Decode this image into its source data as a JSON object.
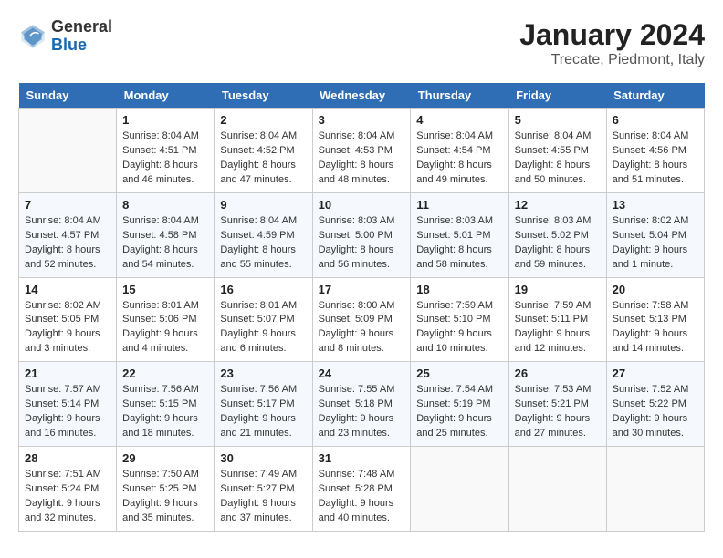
{
  "header": {
    "logo_general": "General",
    "logo_blue": "Blue",
    "title": "January 2024",
    "subtitle": "Trecate, Piedmont, Italy"
  },
  "days_of_week": [
    "Sunday",
    "Monday",
    "Tuesday",
    "Wednesday",
    "Thursday",
    "Friday",
    "Saturday"
  ],
  "weeks": [
    [
      {
        "day": "",
        "info": ""
      },
      {
        "day": "1",
        "info": "Sunrise: 8:04 AM\nSunset: 4:51 PM\nDaylight: 8 hours\nand 46 minutes."
      },
      {
        "day": "2",
        "info": "Sunrise: 8:04 AM\nSunset: 4:52 PM\nDaylight: 8 hours\nand 47 minutes."
      },
      {
        "day": "3",
        "info": "Sunrise: 8:04 AM\nSunset: 4:53 PM\nDaylight: 8 hours\nand 48 minutes."
      },
      {
        "day": "4",
        "info": "Sunrise: 8:04 AM\nSunset: 4:54 PM\nDaylight: 8 hours\nand 49 minutes."
      },
      {
        "day": "5",
        "info": "Sunrise: 8:04 AM\nSunset: 4:55 PM\nDaylight: 8 hours\nand 50 minutes."
      },
      {
        "day": "6",
        "info": "Sunrise: 8:04 AM\nSunset: 4:56 PM\nDaylight: 8 hours\nand 51 minutes."
      }
    ],
    [
      {
        "day": "7",
        "info": "Sunrise: 8:04 AM\nSunset: 4:57 PM\nDaylight: 8 hours\nand 52 minutes."
      },
      {
        "day": "8",
        "info": "Sunrise: 8:04 AM\nSunset: 4:58 PM\nDaylight: 8 hours\nand 54 minutes."
      },
      {
        "day": "9",
        "info": "Sunrise: 8:04 AM\nSunset: 4:59 PM\nDaylight: 8 hours\nand 55 minutes."
      },
      {
        "day": "10",
        "info": "Sunrise: 8:03 AM\nSunset: 5:00 PM\nDaylight: 8 hours\nand 56 minutes."
      },
      {
        "day": "11",
        "info": "Sunrise: 8:03 AM\nSunset: 5:01 PM\nDaylight: 8 hours\nand 58 minutes."
      },
      {
        "day": "12",
        "info": "Sunrise: 8:03 AM\nSunset: 5:02 PM\nDaylight: 8 hours\nand 59 minutes."
      },
      {
        "day": "13",
        "info": "Sunrise: 8:02 AM\nSunset: 5:04 PM\nDaylight: 9 hours\nand 1 minute."
      }
    ],
    [
      {
        "day": "14",
        "info": "Sunrise: 8:02 AM\nSunset: 5:05 PM\nDaylight: 9 hours\nand 3 minutes."
      },
      {
        "day": "15",
        "info": "Sunrise: 8:01 AM\nSunset: 5:06 PM\nDaylight: 9 hours\nand 4 minutes."
      },
      {
        "day": "16",
        "info": "Sunrise: 8:01 AM\nSunset: 5:07 PM\nDaylight: 9 hours\nand 6 minutes."
      },
      {
        "day": "17",
        "info": "Sunrise: 8:00 AM\nSunset: 5:09 PM\nDaylight: 9 hours\nand 8 minutes."
      },
      {
        "day": "18",
        "info": "Sunrise: 7:59 AM\nSunset: 5:10 PM\nDaylight: 9 hours\nand 10 minutes."
      },
      {
        "day": "19",
        "info": "Sunrise: 7:59 AM\nSunset: 5:11 PM\nDaylight: 9 hours\nand 12 minutes."
      },
      {
        "day": "20",
        "info": "Sunrise: 7:58 AM\nSunset: 5:13 PM\nDaylight: 9 hours\nand 14 minutes."
      }
    ],
    [
      {
        "day": "21",
        "info": "Sunrise: 7:57 AM\nSunset: 5:14 PM\nDaylight: 9 hours\nand 16 minutes."
      },
      {
        "day": "22",
        "info": "Sunrise: 7:56 AM\nSunset: 5:15 PM\nDaylight: 9 hours\nand 18 minutes."
      },
      {
        "day": "23",
        "info": "Sunrise: 7:56 AM\nSunset: 5:17 PM\nDaylight: 9 hours\nand 21 minutes."
      },
      {
        "day": "24",
        "info": "Sunrise: 7:55 AM\nSunset: 5:18 PM\nDaylight: 9 hours\nand 23 minutes."
      },
      {
        "day": "25",
        "info": "Sunrise: 7:54 AM\nSunset: 5:19 PM\nDaylight: 9 hours\nand 25 minutes."
      },
      {
        "day": "26",
        "info": "Sunrise: 7:53 AM\nSunset: 5:21 PM\nDaylight: 9 hours\nand 27 minutes."
      },
      {
        "day": "27",
        "info": "Sunrise: 7:52 AM\nSunset: 5:22 PM\nDaylight: 9 hours\nand 30 minutes."
      }
    ],
    [
      {
        "day": "28",
        "info": "Sunrise: 7:51 AM\nSunset: 5:24 PM\nDaylight: 9 hours\nand 32 minutes."
      },
      {
        "day": "29",
        "info": "Sunrise: 7:50 AM\nSunset: 5:25 PM\nDaylight: 9 hours\nand 35 minutes."
      },
      {
        "day": "30",
        "info": "Sunrise: 7:49 AM\nSunset: 5:27 PM\nDaylight: 9 hours\nand 37 minutes."
      },
      {
        "day": "31",
        "info": "Sunrise: 7:48 AM\nSunset: 5:28 PM\nDaylight: 9 hours\nand 40 minutes."
      },
      {
        "day": "",
        "info": ""
      },
      {
        "day": "",
        "info": ""
      },
      {
        "day": "",
        "info": ""
      }
    ]
  ]
}
